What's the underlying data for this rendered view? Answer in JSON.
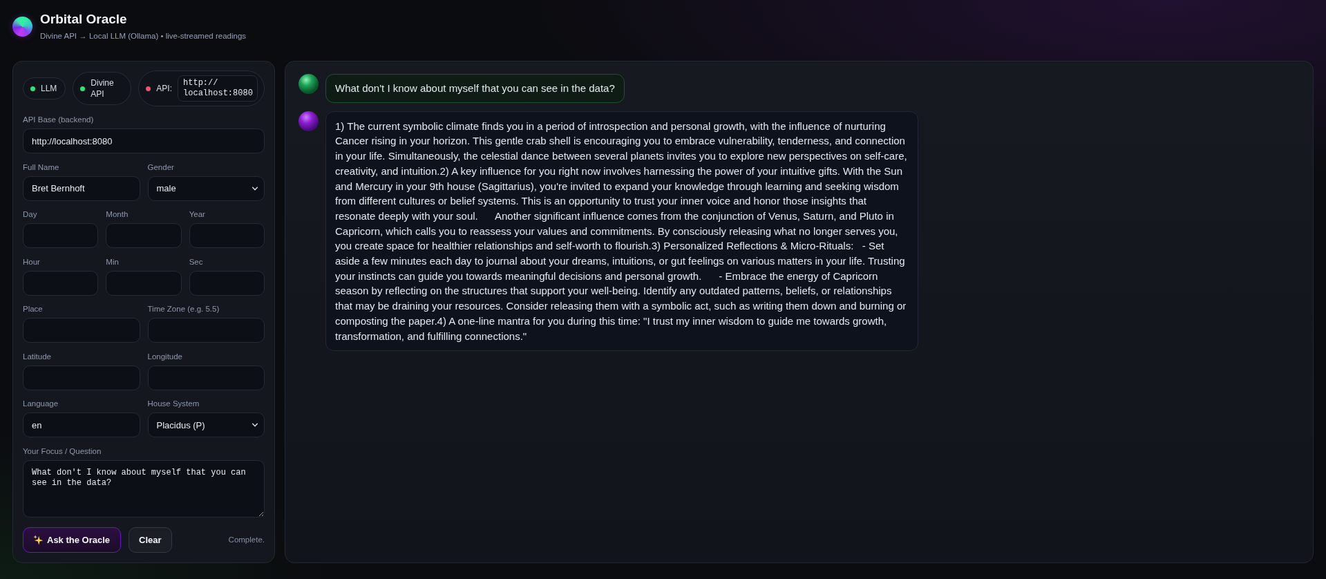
{
  "header": {
    "title": "Orbital Oracle",
    "subtitle": "Divine API → Local LLM (Ollama) • live-streamed readings"
  },
  "status_pills": [
    {
      "kind": "status",
      "label": "LLM",
      "color": "#2ee27f"
    },
    {
      "kind": "status",
      "label": "Divine API",
      "color": "#2ee27f"
    },
    {
      "kind": "endpoint",
      "label": "API:",
      "color": "#f2506f",
      "value": "http://localhost:8080"
    }
  ],
  "form": {
    "rows": [
      [
        {
          "kind": "text",
          "label": "API Base (backend)",
          "value": "http://localhost:8080"
        }
      ],
      [
        {
          "kind": "text",
          "label": "Full Name",
          "value": "Bret Bernhoft"
        },
        {
          "kind": "select",
          "label": "Gender",
          "value": "male"
        }
      ],
      [
        {
          "kind": "text",
          "label": "Day"
        },
        {
          "kind": "text",
          "label": "Month"
        },
        {
          "kind": "text",
          "label": "Year"
        }
      ],
      [
        {
          "kind": "text",
          "label": "Hour"
        },
        {
          "kind": "text",
          "label": "Min"
        },
        {
          "kind": "text",
          "label": "Sec"
        }
      ],
      [
        {
          "kind": "text",
          "label": "Place"
        },
        {
          "kind": "text",
          "label": "Time Zone (e.g. 5.5)"
        }
      ],
      [
        {
          "kind": "text",
          "label": "Latitude"
        },
        {
          "kind": "text",
          "label": "Longitude"
        }
      ],
      [
        {
          "kind": "text",
          "label": "Language",
          "value": "en"
        },
        {
          "kind": "select",
          "label": "House System",
          "value": "Placidus (P)"
        }
      ],
      [
        {
          "kind": "textarea",
          "label": "Your Focus / Question",
          "value": "What don't I know about myself that you can see in the data?"
        }
      ]
    ]
  },
  "actions": {
    "buttons": [
      {
        "kind": "primary",
        "label": "Ask the Oracle"
      },
      {
        "kind": "secondary",
        "label": "Clear"
      }
    ],
    "status_text": "Complete."
  },
  "chat": {
    "messages": [
      {
        "kind": "user",
        "text": "What don't I know about myself that you can see in the data?"
      },
      {
        "kind": "oracle",
        "text": "1) The current symbolic climate finds you in a period of introspection and personal growth, with the influence of nurturing Cancer rising in your horizon. This gentle crab shell is encouraging you to embrace vulnerability, tenderness, and connection in your life. Simultaneously, the celestial dance between several planets invites you to explore new perspectives on self-care, creativity, and intuition.2) A key influence for you right now involves harnessing the power of your intuitive gifts. With the Sun and Mercury in your 9th house (Sagittarius), you're invited to expand your knowledge through learning and seeking wisdom from different cultures or belief systems. This is an opportunity to trust your inner voice and honor those insights that resonate deeply with your soul.      Another significant influence comes from the conjunction of Venus, Saturn, and Pluto in Capricorn, which calls you to reassess your values and commitments. By consciously releasing what no longer serves you, you create space for healthier relationships and self-worth to flourish.3) Personalized Reflections & Micro-Rituals:   - Set aside a few minutes each day to journal about your dreams, intuitions, or gut feelings on various matters in your life. Trusting your instincts can guide you towards meaningful decisions and personal growth.      - Embrace the energy of Capricorn season by reflecting on the structures that support your well-being. Identify any outdated patterns, beliefs, or relationships that may be draining your resources. Consider releasing them with a symbolic act, such as writing them down and burning or composting the paper.4) A one-line mantra for you during this time: \"I trust my inner wisdom to guide me towards growth, transformation, and fulfilling connections.\""
      }
    ]
  }
}
